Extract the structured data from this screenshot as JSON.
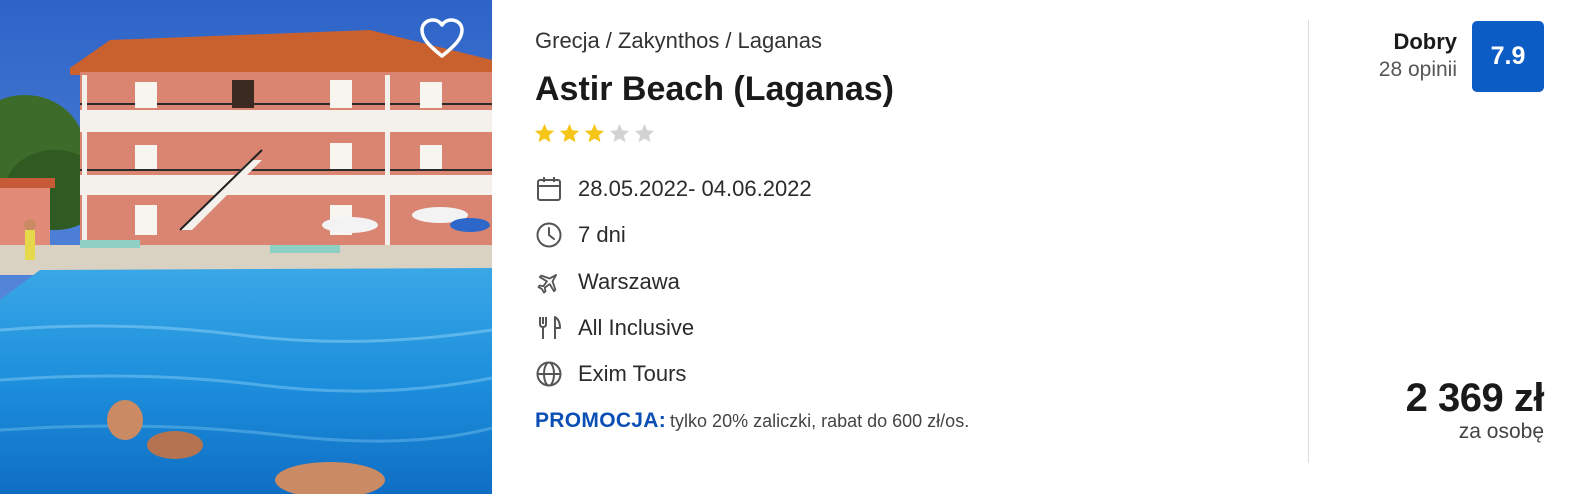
{
  "hotel": {
    "breadcrumb": [
      "Grecja",
      "Zakynthos",
      "Laganas"
    ],
    "breadcrumb_separator": "/",
    "name": "Astir Beach (Laganas)",
    "stars": 3,
    "max_stars": 5
  },
  "features": [
    {
      "icon": "calendar-icon",
      "text": "28.05.2022- 04.06.2022"
    },
    {
      "icon": "clock-icon",
      "text": "7 dni"
    },
    {
      "icon": "plane-icon",
      "text": "Warszawa"
    },
    {
      "icon": "cutlery-icon",
      "text": "All Inclusive"
    },
    {
      "icon": "globe-icon",
      "text": "Exim Tours"
    }
  ],
  "promo": {
    "label": "PROMOCJA:",
    "text": "tylko 20% zaliczki, rabat do 600 zł/os."
  },
  "rating": {
    "label": "Dobry",
    "count": "28 opinii",
    "score": "7.9"
  },
  "price": {
    "amount": "2 369 zł",
    "per": "za osobę"
  },
  "colors": {
    "accent": "#0b5cc4",
    "promo": "#0b4fb5",
    "star_on": "#f5c518",
    "star_off": "#d3d3d3"
  }
}
